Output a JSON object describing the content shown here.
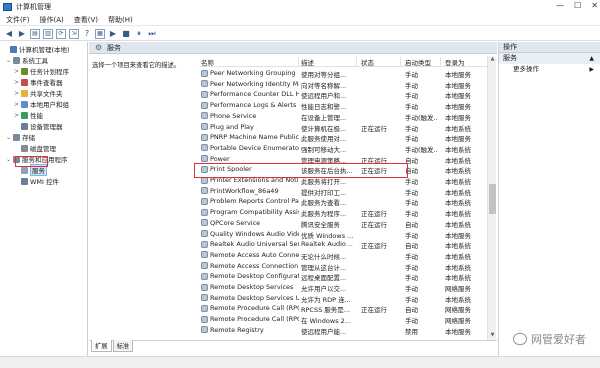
{
  "window": {
    "title": "计算机管理",
    "minimize": "—",
    "maximize": "☐",
    "close": "✕"
  },
  "menu": [
    "文件(F)",
    "操作(A)",
    "查看(V)",
    "帮助(H)"
  ],
  "tree": {
    "items": [
      {
        "label": "计算机管理(本地)",
        "level": 0,
        "expander": "",
        "icon_color": "#4a7bb7"
      },
      {
        "label": "系统工具",
        "level": 1,
        "expander": "⌄",
        "icon_color": "#7a8a9a"
      },
      {
        "label": "任务计划程序",
        "level": 2,
        "expander": ">",
        "icon_color": "#6b8e23"
      },
      {
        "label": "事件查看器",
        "level": 2,
        "expander": ">",
        "icon_color": "#c0504d"
      },
      {
        "label": "共享文件夹",
        "level": 2,
        "expander": ">",
        "icon_color": "#e3b341"
      },
      {
        "label": "本地用户和组",
        "level": 2,
        "expander": ">",
        "icon_color": "#5b8fc9"
      },
      {
        "label": "性能",
        "level": 2,
        "expander": ">",
        "icon_color": "#3c9a5f"
      },
      {
        "label": "设备管理器",
        "level": 2,
        "expander": "",
        "icon_color": "#6a7f99"
      },
      {
        "label": "存储",
        "level": 1,
        "expander": "⌄",
        "icon_color": "#7a8a9a"
      },
      {
        "label": "磁盘管理",
        "level": 2,
        "expander": "",
        "icon_color": "#8a8a8a"
      },
      {
        "label": "服务和应用程序",
        "level": 1,
        "expander": "⌄",
        "icon_color": "#7a8a9a"
      },
      {
        "label": "服务",
        "level": 2,
        "expander": "",
        "icon_color": "#8fa4ba",
        "selected": true
      },
      {
        "label": "WMI 控件",
        "level": 2,
        "expander": "",
        "icon_color": "#6a7f99"
      }
    ]
  },
  "content": {
    "header_title": "服务",
    "description": "选择一个项目来查看它的描述。",
    "columns": {
      "name": "名称",
      "desc": "描述",
      "status": "状态",
      "start": "启动类型",
      "logon": "登录为"
    },
    "rows": [
      {
        "name": "Peer Networking Grouping",
        "desc": "使用对等分组...",
        "status": "",
        "start": "手动",
        "logon": "本地服务"
      },
      {
        "name": "Peer Networking Identity Man...",
        "desc": "向对等名称解...",
        "status": "",
        "start": "手动",
        "logon": "本地服务"
      },
      {
        "name": "Performance Counter DLL Host",
        "desc": "使远程用户和...",
        "status": "",
        "start": "手动",
        "logon": "本地服务"
      },
      {
        "name": "Performance Logs & Alerts",
        "desc": "性能日志和警...",
        "status": "",
        "start": "手动",
        "logon": "本地服务"
      },
      {
        "name": "Phone Service",
        "desc": "在设备上管理...",
        "status": "",
        "start": "手动(触发...",
        "logon": "本地服务"
      },
      {
        "name": "Plug and Play",
        "desc": "使计算机在极...",
        "status": "正在运行",
        "start": "手动",
        "logon": "本地系统"
      },
      {
        "name": "PNRP Machine Name Publicati...",
        "desc": "此服务使用对...",
        "status": "",
        "start": "手动",
        "logon": "本地服务"
      },
      {
        "name": "Portable Device Enumerator S...",
        "desc": "强制可移动大...",
        "status": "",
        "start": "手动(触发...",
        "logon": "本地系统"
      },
      {
        "name": "Power",
        "desc": "管理电源策略...",
        "status": "正在运行",
        "start": "自动",
        "logon": "本地系统"
      },
      {
        "name": "Print Spooler",
        "desc": "该服务在后台执...",
        "status": "正在运行",
        "start": "自动",
        "logon": "本地系统"
      },
      {
        "name": "Printer Extensions and Notifica...",
        "desc": "此服务将打开...",
        "status": "",
        "start": "手动",
        "logon": "本地系统"
      },
      {
        "name": "PrintWorkflow_86a49",
        "desc": "提供对打印工...",
        "status": "",
        "start": "手动",
        "logon": "本地系统"
      },
      {
        "name": "Problem Reports Control Pane...",
        "desc": "此服务为查看...",
        "status": "",
        "start": "手动",
        "logon": "本地系统"
      },
      {
        "name": "Program Compatibility Assista...",
        "desc": "此服务为程序...",
        "status": "正在运行",
        "start": "手动",
        "logon": "本地系统"
      },
      {
        "name": "QPCore Service",
        "desc": "腾讯安全服务",
        "status": "正在运行",
        "start": "自动",
        "logon": "本地系统"
      },
      {
        "name": "Quality Windows Audio Video ...",
        "desc": "优质 Windows ...",
        "status": "",
        "start": "手动",
        "logon": "本地服务"
      },
      {
        "name": "Realtek Audio Universal Service",
        "desc": "Realtek Audio ...",
        "status": "正在运行",
        "start": "自动",
        "logon": "本地系统"
      },
      {
        "name": "Remote Access Auto Connecti...",
        "desc": "无论什么时候...",
        "status": "",
        "start": "手动",
        "logon": "本地系统"
      },
      {
        "name": "Remote Access Connection M...",
        "desc": "管理从这台计...",
        "status": "",
        "start": "手动",
        "logon": "本地系统"
      },
      {
        "name": "Remote Desktop Configuration",
        "desc": "远程桌面配置...",
        "status": "",
        "start": "手动",
        "logon": "本地系统"
      },
      {
        "name": "Remote Desktop Services",
        "desc": "允许用户以交...",
        "status": "",
        "start": "手动",
        "logon": "网络服务"
      },
      {
        "name": "Remote Desktop Services Use...",
        "desc": "允许为 RDP 连...",
        "status": "",
        "start": "手动",
        "logon": "本地系统"
      },
      {
        "name": "Remote Procedure Call (RPC)",
        "desc": "RPCSS 服务是...",
        "status": "正在运行",
        "start": "自动",
        "logon": "网络服务"
      },
      {
        "name": "Remote Procedure Call (RPC) ...",
        "desc": "在 Windows 2...",
        "status": "",
        "start": "手动",
        "logon": "网络服务"
      },
      {
        "name": "Remote Registry",
        "desc": "使远程用户能...",
        "status": "",
        "start": "禁用",
        "logon": "本地服务"
      }
    ],
    "tabs": [
      "扩展",
      "标准"
    ]
  },
  "actions": {
    "header": "操作",
    "section": "服务",
    "more": "更多操作"
  },
  "watermark": "网管爱好者",
  "colors": {
    "highlight_border": "#e0303a",
    "selection_bg": "#cde6f7",
    "pane_header_bg": "#dfe6ee"
  }
}
